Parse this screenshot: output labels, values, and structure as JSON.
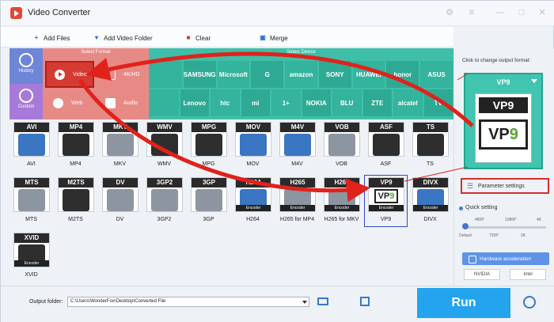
{
  "window": {
    "title": "Video Converter",
    "min_label": "—",
    "max_label": "□",
    "close_label": "✕",
    "settings_label": "⚙",
    "menu_label": "≡"
  },
  "toolbar": {
    "add_files": "Add Files",
    "add_video_folder": "Add Video Folder",
    "clear": "Clear",
    "merge": "Merge"
  },
  "left_tabs": [
    {
      "label": "History",
      "icon": "clock-icon"
    },
    {
      "label": "Custom",
      "icon": "custom-icon"
    }
  ],
  "select_format": {
    "heading": "Select Format",
    "buttons": [
      {
        "label": "Video",
        "icon": "play-icon",
        "selected": true
      },
      {
        "label": "4K/HD",
        "icon": "4k-icon",
        "selected": false
      },
      {
        "label": "Web",
        "icon": "chrome-icon",
        "selected": false
      },
      {
        "label": "Audio",
        "icon": "speaker-icon",
        "selected": false
      }
    ]
  },
  "select_device": {
    "heading": "Select Device",
    "row1": [
      "",
      "SAMSUNG",
      "Microsoft",
      "G",
      "amazon",
      "SONY",
      "HUAWEI",
      "honor",
      "ASUS"
    ],
    "row2": [
      "",
      "Lenovo",
      "htc",
      "mi",
      "1+",
      "NOKIA",
      "BLU",
      "ZTE",
      "alcatel",
      "TV"
    ]
  },
  "formats": [
    {
      "name": "AVI",
      "caption": "AVI",
      "style": "blue"
    },
    {
      "name": "MP4",
      "caption": "MP4",
      "style": "dark"
    },
    {
      "name": "MKV",
      "caption": "MKV",
      "style": "grey"
    },
    {
      "name": "WMV",
      "caption": "WMV",
      "style": "dark"
    },
    {
      "name": "MPG",
      "caption": "MPG",
      "style": "dark"
    },
    {
      "name": "MOV",
      "caption": "MOV",
      "style": "blue"
    },
    {
      "name": "M4V",
      "caption": "M4V",
      "style": "blue"
    },
    {
      "name": "VOB",
      "caption": "VOB",
      "style": "grey"
    },
    {
      "name": "ASF",
      "caption": "ASF",
      "style": "dark"
    },
    {
      "name": "TS",
      "caption": "TS",
      "style": "dark"
    },
    {
      "name": "MTS",
      "caption": "MTS",
      "style": "grey"
    },
    {
      "name": "M2TS",
      "caption": "M2TS",
      "style": "dark"
    },
    {
      "name": "DV",
      "caption": "DV",
      "style": "grey"
    },
    {
      "name": "3GP2",
      "caption": "3GP2",
      "style": "grey"
    },
    {
      "name": "3GP",
      "caption": "3GP",
      "style": "grey"
    },
    {
      "name": "H264",
      "caption": "H264",
      "style": "blue",
      "encoder": "Encoder"
    },
    {
      "name": "H265",
      "caption": "H265 for MP4",
      "style": "grey",
      "encoder": "Encoder"
    },
    {
      "name": "H265",
      "caption": "H265 for MKV",
      "style": "grey",
      "encoder": "Encoder"
    },
    {
      "name": "VP9",
      "caption": "VP9",
      "style": "vp9",
      "encoder": "Encoder",
      "selected": true
    },
    {
      "name": "DIVX",
      "caption": "DIVX",
      "style": "blue",
      "encoder": "Encoder"
    },
    {
      "name": "XVID",
      "caption": "XVID",
      "style": "dark",
      "encoder": "Encoder"
    }
  ],
  "output_format": {
    "hint": "Click to change output format:",
    "name": "VP9",
    "icon_top": "VP9",
    "icon_mid_a": "VP",
    "icon_mid_b": "9"
  },
  "parameter_settings": "Parameter settings",
  "quick_setting": {
    "label": "Quick setting",
    "top_labels": [
      "480P",
      "1080P",
      "4K"
    ],
    "bottom_labels": [
      "Default",
      "720P",
      "2K"
    ],
    "level": 0
  },
  "hardware_acceleration": "Hardware acceleration",
  "chips": [
    "NVIDIA",
    "Intel"
  ],
  "bottom": {
    "output_folder_label": "Output folder:",
    "output_path": "C:\\Users\\WonderFox\\Desktop\\Converted File",
    "run_label": "Run"
  },
  "colors": {
    "accent_red": "#d53a33",
    "format_panel": "#e78a86",
    "device_panel": "#3fbfa9",
    "run_blue": "#24a4ee"
  }
}
